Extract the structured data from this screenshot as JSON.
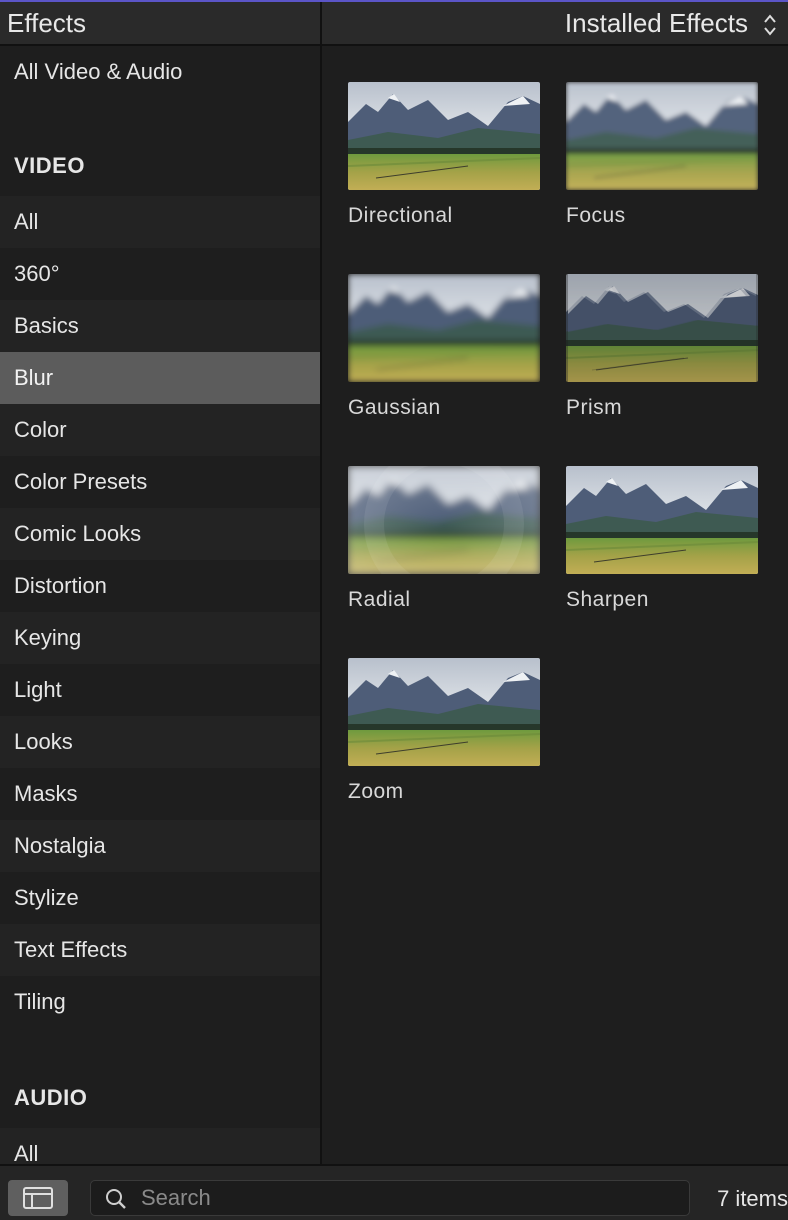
{
  "header": {
    "title": "Effects",
    "installed_label": "Installed Effects"
  },
  "sidebar": {
    "top_item": "All Video & Audio",
    "video_section": "VIDEO",
    "video_items": [
      "All",
      "360°",
      "Basics",
      "Blur",
      "Color",
      "Color Presets",
      "Comic Looks",
      "Distortion",
      "Keying",
      "Light",
      "Looks",
      "Masks",
      "Nostalgia",
      "Stylize",
      "Text Effects",
      "Tiling"
    ],
    "selected": "Blur",
    "audio_section": "AUDIO",
    "audio_items": [
      "All"
    ]
  },
  "effects": [
    {
      "label": "Directional",
      "style": "sharp"
    },
    {
      "label": "Focus",
      "style": "focus"
    },
    {
      "label": "Gaussian",
      "style": "blur"
    },
    {
      "label": "Prism",
      "style": "prism"
    },
    {
      "label": "Radial",
      "style": "radial"
    },
    {
      "label": "Sharpen",
      "style": "sharp"
    },
    {
      "label": "Zoom",
      "style": "sharp"
    }
  ],
  "search": {
    "placeholder": "Search",
    "value": ""
  },
  "status": {
    "count": "7 items"
  },
  "icons": {
    "stepper": "up-down-chevron-icon",
    "sidebar_toggle": "sidebar-toggle-icon",
    "search": "search-icon"
  },
  "colors": {
    "accent_line": "#5b55c8",
    "selected_row": "#5c5c5c",
    "background": "#1e1e1e"
  }
}
